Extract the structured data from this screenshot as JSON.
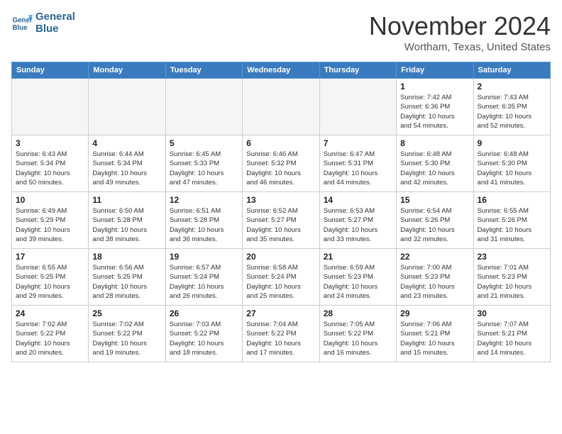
{
  "header": {
    "logo_line1": "General",
    "logo_line2": "Blue",
    "month": "November 2024",
    "location": "Wortham, Texas, United States"
  },
  "weekdays": [
    "Sunday",
    "Monday",
    "Tuesday",
    "Wednesday",
    "Thursday",
    "Friday",
    "Saturday"
  ],
  "weeks": [
    [
      {
        "day": "",
        "detail": ""
      },
      {
        "day": "",
        "detail": ""
      },
      {
        "day": "",
        "detail": ""
      },
      {
        "day": "",
        "detail": ""
      },
      {
        "day": "",
        "detail": ""
      },
      {
        "day": "1",
        "detail": "Sunrise: 7:42 AM\nSunset: 6:36 PM\nDaylight: 10 hours\nand 54 minutes."
      },
      {
        "day": "2",
        "detail": "Sunrise: 7:43 AM\nSunset: 6:35 PM\nDaylight: 10 hours\nand 52 minutes."
      }
    ],
    [
      {
        "day": "3",
        "detail": "Sunrise: 6:43 AM\nSunset: 5:34 PM\nDaylight: 10 hours\nand 50 minutes."
      },
      {
        "day": "4",
        "detail": "Sunrise: 6:44 AM\nSunset: 5:34 PM\nDaylight: 10 hours\nand 49 minutes."
      },
      {
        "day": "5",
        "detail": "Sunrise: 6:45 AM\nSunset: 5:33 PM\nDaylight: 10 hours\nand 47 minutes."
      },
      {
        "day": "6",
        "detail": "Sunrise: 6:46 AM\nSunset: 5:32 PM\nDaylight: 10 hours\nand 46 minutes."
      },
      {
        "day": "7",
        "detail": "Sunrise: 6:47 AM\nSunset: 5:31 PM\nDaylight: 10 hours\nand 44 minutes."
      },
      {
        "day": "8",
        "detail": "Sunrise: 6:48 AM\nSunset: 5:30 PM\nDaylight: 10 hours\nand 42 minutes."
      },
      {
        "day": "9",
        "detail": "Sunrise: 6:48 AM\nSunset: 5:30 PM\nDaylight: 10 hours\nand 41 minutes."
      }
    ],
    [
      {
        "day": "10",
        "detail": "Sunrise: 6:49 AM\nSunset: 5:29 PM\nDaylight: 10 hours\nand 39 minutes."
      },
      {
        "day": "11",
        "detail": "Sunrise: 6:50 AM\nSunset: 5:28 PM\nDaylight: 10 hours\nand 38 minutes."
      },
      {
        "day": "12",
        "detail": "Sunrise: 6:51 AM\nSunset: 5:28 PM\nDaylight: 10 hours\nand 36 minutes."
      },
      {
        "day": "13",
        "detail": "Sunrise: 6:52 AM\nSunset: 5:27 PM\nDaylight: 10 hours\nand 35 minutes."
      },
      {
        "day": "14",
        "detail": "Sunrise: 6:53 AM\nSunset: 5:27 PM\nDaylight: 10 hours\nand 33 minutes."
      },
      {
        "day": "15",
        "detail": "Sunrise: 6:54 AM\nSunset: 5:26 PM\nDaylight: 10 hours\nand 32 minutes."
      },
      {
        "day": "16",
        "detail": "Sunrise: 6:55 AM\nSunset: 5:26 PM\nDaylight: 10 hours\nand 31 minutes."
      }
    ],
    [
      {
        "day": "17",
        "detail": "Sunrise: 6:55 AM\nSunset: 5:25 PM\nDaylight: 10 hours\nand 29 minutes."
      },
      {
        "day": "18",
        "detail": "Sunrise: 6:56 AM\nSunset: 5:25 PM\nDaylight: 10 hours\nand 28 minutes."
      },
      {
        "day": "19",
        "detail": "Sunrise: 6:57 AM\nSunset: 5:24 PM\nDaylight: 10 hours\nand 26 minutes."
      },
      {
        "day": "20",
        "detail": "Sunrise: 6:58 AM\nSunset: 5:24 PM\nDaylight: 10 hours\nand 25 minutes."
      },
      {
        "day": "21",
        "detail": "Sunrise: 6:59 AM\nSunset: 5:23 PM\nDaylight: 10 hours\nand 24 minutes."
      },
      {
        "day": "22",
        "detail": "Sunrise: 7:00 AM\nSunset: 5:23 PM\nDaylight: 10 hours\nand 23 minutes."
      },
      {
        "day": "23",
        "detail": "Sunrise: 7:01 AM\nSunset: 5:23 PM\nDaylight: 10 hours\nand 21 minutes."
      }
    ],
    [
      {
        "day": "24",
        "detail": "Sunrise: 7:02 AM\nSunset: 5:22 PM\nDaylight: 10 hours\nand 20 minutes."
      },
      {
        "day": "25",
        "detail": "Sunrise: 7:02 AM\nSunset: 5:22 PM\nDaylight: 10 hours\nand 19 minutes."
      },
      {
        "day": "26",
        "detail": "Sunrise: 7:03 AM\nSunset: 5:22 PM\nDaylight: 10 hours\nand 18 minutes."
      },
      {
        "day": "27",
        "detail": "Sunrise: 7:04 AM\nSunset: 5:22 PM\nDaylight: 10 hours\nand 17 minutes."
      },
      {
        "day": "28",
        "detail": "Sunrise: 7:05 AM\nSunset: 5:22 PM\nDaylight: 10 hours\nand 16 minutes."
      },
      {
        "day": "29",
        "detail": "Sunrise: 7:06 AM\nSunset: 5:21 PM\nDaylight: 10 hours\nand 15 minutes."
      },
      {
        "day": "30",
        "detail": "Sunrise: 7:07 AM\nSunset: 5:21 PM\nDaylight: 10 hours\nand 14 minutes."
      }
    ]
  ]
}
